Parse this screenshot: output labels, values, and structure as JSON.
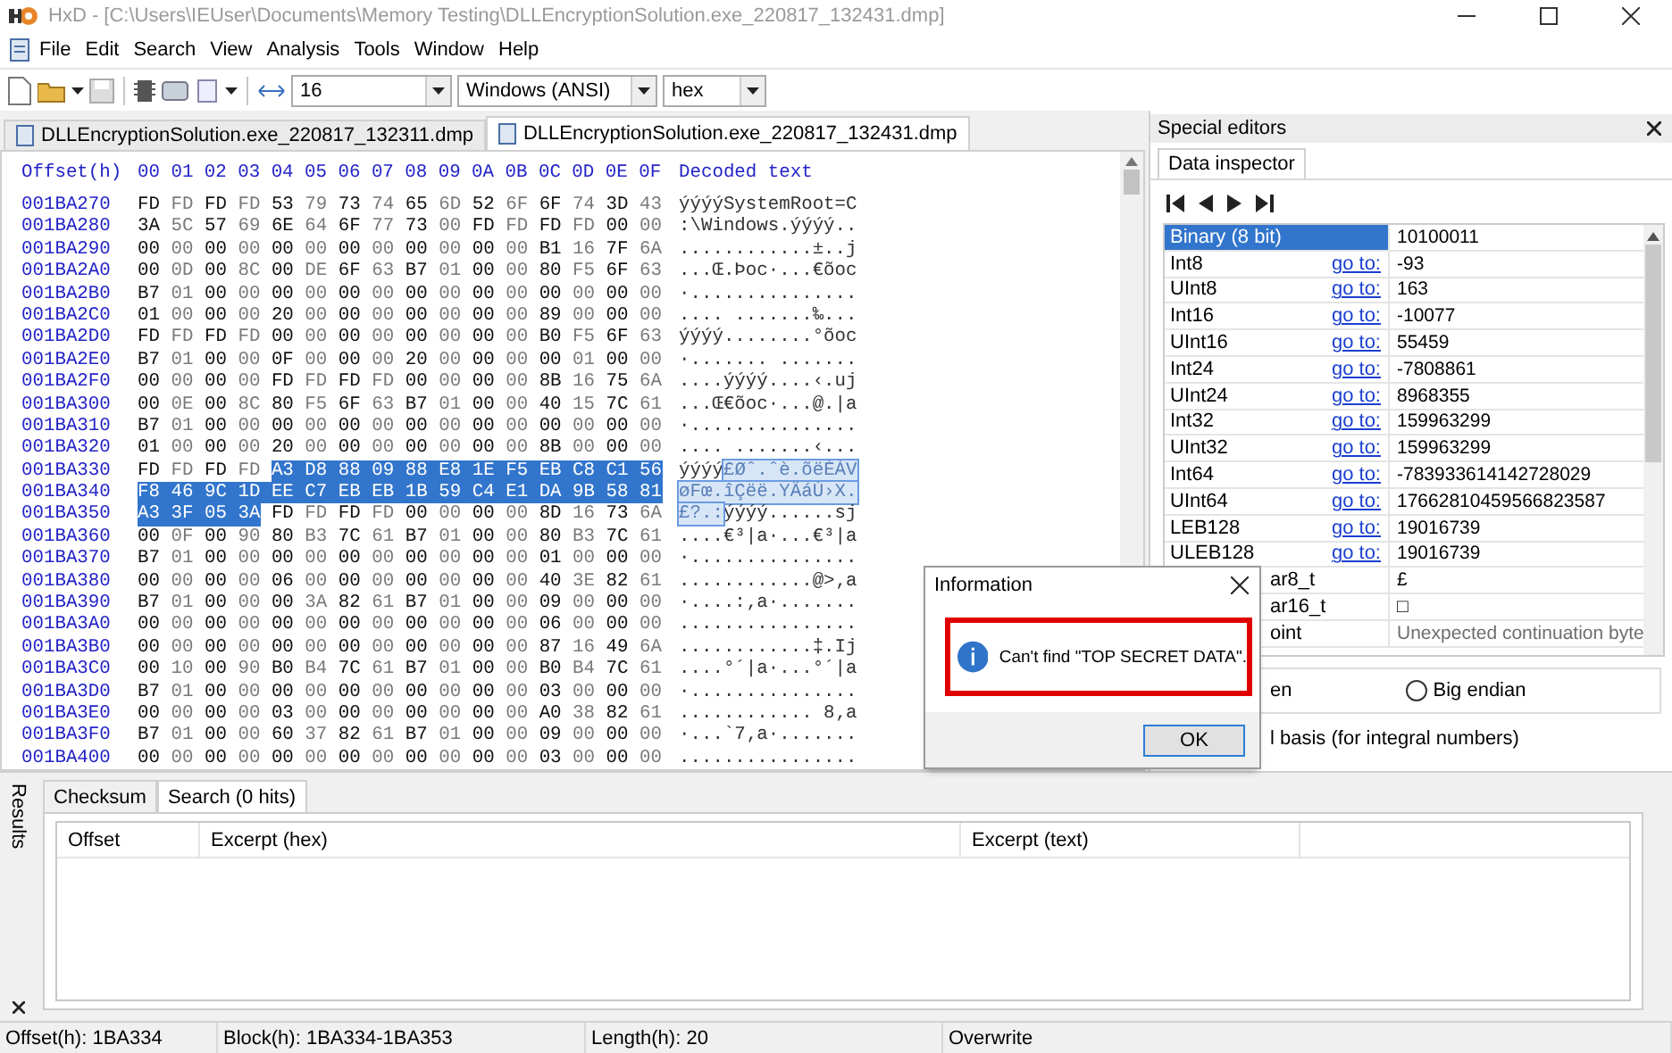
{
  "window": {
    "title": "HxD - [C:\\Users\\IEUser\\Documents\\Memory Testing\\DLLEncryptionSolution.exe_220817_132431.dmp]"
  },
  "menu": [
    "File",
    "Edit",
    "Search",
    "View",
    "Analysis",
    "Tools",
    "Window",
    "Help"
  ],
  "toolbar": {
    "combos": [
      {
        "value": "16"
      },
      {
        "value": "Windows (ANSI)"
      },
      {
        "value": "hex"
      }
    ]
  },
  "tabs": [
    {
      "label": "DLLEncryptionSolution.exe_220817_132311.dmp",
      "selected": false
    },
    {
      "label": "DLLEncryptionSolution.exe_220817_132431.dmp",
      "selected": true
    }
  ],
  "hex": {
    "offset_header": "Offset(h)",
    "column_header": "00 01 02 03 04 05 06 07 08 09 0A 0B 0C 0D 0E 0F",
    "text_header": "Decoded text",
    "rows": [
      {
        "offset": "001BA270",
        "hex": [
          {
            "text": "FD FD FD FD 53 79 73 74 65 6D 52 6F 6F 74 3D 43",
            "selected": false
          }
        ],
        "text": [
          {
            "text": "ýýýýSystemRoot=C",
            "selected": false
          }
        ]
      },
      {
        "offset": "001BA280",
        "hex": [
          {
            "text": "3A 5C 57 69 6E 64 6F 77 73 00 FD FD FD FD 00 00",
            "selected": false
          }
        ],
        "text": [
          {
            "text": ":\\Windows.ýýýý..",
            "selected": false
          }
        ]
      },
      {
        "offset": "001BA290",
        "hex": [
          {
            "text": "00 00 00 00 00 00 00 00 00 00 00 00 B1 16 7F 6A",
            "selected": false
          }
        ],
        "text": [
          {
            "text": "............±..j",
            "selected": false
          }
        ]
      },
      {
        "offset": "001BA2A0",
        "hex": [
          {
            "text": "00 0D 00 8C 00 DE 6F 63 B7 01 00 00 80 F5 6F 63",
            "selected": false
          }
        ],
        "text": [
          {
            "text": "...Œ.Þoc·...€õoc",
            "selected": false
          }
        ]
      },
      {
        "offset": "001BA2B0",
        "hex": [
          {
            "text": "B7 01 00 00 00 00 00 00 00 00 00 00 00 00 00 00",
            "selected": false
          }
        ],
        "text": [
          {
            "text": "·...............",
            "selected": false
          }
        ]
      },
      {
        "offset": "001BA2C0",
        "hex": [
          {
            "text": "01 00 00 00 20 00 00 00 00 00 00 00 89 00 00 00",
            "selected": false
          }
        ],
        "text": [
          {
            "text": ".... .......‰...",
            "selected": false
          }
        ]
      },
      {
        "offset": "001BA2D0",
        "hex": [
          {
            "text": "FD FD FD FD 00 00 00 00 00 00 00 00 B0 F5 6F 63",
            "selected": false
          }
        ],
        "text": [
          {
            "text": "ýýýý........°õoc",
            "selected": false
          }
        ]
      },
      {
        "offset": "001BA2E0",
        "hex": [
          {
            "text": "B7 01 00 00 0F 00 00 00 20 00 00 00 00 01 00 00",
            "selected": false
          }
        ],
        "text": [
          {
            "text": "·....... .......",
            "selected": false
          }
        ]
      },
      {
        "offset": "001BA2F0",
        "hex": [
          {
            "text": "00 00 00 00 FD FD FD FD 00 00 00 00 8B 16 75 6A",
            "selected": false
          }
        ],
        "text": [
          {
            "text": "....ýýýý....‹.uj",
            "selected": false
          }
        ]
      },
      {
        "offset": "001BA300",
        "hex": [
          {
            "text": "00 0E 00 8C 80 F5 6F 63 B7 01 00 00 40 15 7C 61",
            "selected": false
          }
        ],
        "text": [
          {
            "text": "...Œ€õoc·...@.|a",
            "selected": false
          }
        ]
      },
      {
        "offset": "001BA310",
        "hex": [
          {
            "text": "B7 01 00 00 00 00 00 00 00 00 00 00 00 00 00 00",
            "selected": false
          }
        ],
        "text": [
          {
            "text": "·...............",
            "selected": false
          }
        ]
      },
      {
        "offset": "001BA320",
        "hex": [
          {
            "text": "01 00 00 00 20 00 00 00 00 00 00 00 8B 00 00 00",
            "selected": false
          }
        ],
        "text": [
          {
            "text": ".... .......‹...",
            "selected": false
          }
        ]
      },
      {
        "offset": "001BA330",
        "hex": [
          {
            "text": "FD FD FD FD",
            "selected": false
          },
          {
            "text": "A3 D8 88 09 88 E8 1E F5 EB C8 C1 56",
            "selected": true
          }
        ],
        "text": [
          {
            "text": "ýýýý",
            "selected": false
          },
          {
            "text": "£Øˆ.ˆè.õëÈÁV",
            "selected": true
          }
        ]
      },
      {
        "offset": "001BA340",
        "hex": [
          {
            "text": "F8 46 9C 1D EE C7 EB EB 1B 59 C4 E1 DA 9B 58 81",
            "selected": true
          }
        ],
        "text": [
          {
            "text": "øFœ.îÇëë.YÄáÚ›X.",
            "selected": true
          }
        ]
      },
      {
        "offset": "001BA350",
        "hex": [
          {
            "text": "A3 3F 05 3A",
            "selected": true
          },
          {
            "text": "FD FD FD FD 00 00 00 00 8D 16 73 6A",
            "selected": false
          }
        ],
        "text": [
          {
            "text": "£?.:",
            "selected": true
          },
          {
            "text": "ýýýý......sj",
            "selected": false
          }
        ]
      },
      {
        "offset": "001BA360",
        "hex": [
          {
            "text": "00 0F 00 90 80 B3 7C 61 B7 01 00 00 80 B3 7C 61",
            "selected": false
          }
        ],
        "text": [
          {
            "text": "....€³|a·...€³|a",
            "selected": false
          }
        ]
      },
      {
        "offset": "001BA370",
        "hex": [
          {
            "text": "B7 01 00 00 00 00 00 00 00 00 00 00 01 00 00 00",
            "selected": false
          }
        ],
        "text": [
          {
            "text": "·...............",
            "selected": false
          }
        ]
      },
      {
        "offset": "001BA380",
        "hex": [
          {
            "text": "00 00 00 00 06 00 00 00 00 00 00 00 40 3E 82 61",
            "selected": false
          }
        ],
        "text": [
          {
            "text": "............@>‚a",
            "selected": false
          }
        ]
      },
      {
        "offset": "001BA390",
        "hex": [
          {
            "text": "B7 01 00 00 00 3A 82 61 B7 01 00 00 09 00 00 00",
            "selected": false
          }
        ],
        "text": [
          {
            "text": "·....:‚a·.......",
            "selected": false
          }
        ]
      },
      {
        "offset": "001BA3A0",
        "hex": [
          {
            "text": "00 00 00 00 00 00 00 00 00 00 00 00 06 00 00 00",
            "selected": false
          }
        ],
        "text": [
          {
            "text": "................",
            "selected": false
          }
        ]
      },
      {
        "offset": "001BA3B0",
        "hex": [
          {
            "text": "00 00 00 00 00 00 00 00 00 00 00 00 87 16 49 6A",
            "selected": false
          }
        ],
        "text": [
          {
            "text": "............‡.Ij",
            "selected": false
          }
        ]
      },
      {
        "offset": "001BA3C0",
        "hex": [
          {
            "text": "00 10 00 90 B0 B4 7C 61 B7 01 00 00 B0 B4 7C 61",
            "selected": false
          }
        ],
        "text": [
          {
            "text": "....°´|a·...°´|a",
            "selected": false
          }
        ]
      },
      {
        "offset": "001BA3D0",
        "hex": [
          {
            "text": "B7 01 00 00 00 00 00 00 00 00 00 00 03 00 00 00",
            "selected": false
          }
        ],
        "text": [
          {
            "text": "·...............",
            "selected": false
          }
        ]
      },
      {
        "offset": "001BA3E0",
        "hex": [
          {
            "text": "00 00 00 00 03 00 00 00 00 00 00 00 A0 38 82 61",
            "selected": false
          }
        ],
        "text": [
          {
            "text": "............ 8‚a",
            "selected": false
          }
        ]
      },
      {
        "offset": "001BA3F0",
        "hex": [
          {
            "text": "B7 01 00 00 60 37 82 61 B7 01 00 00 09 00 00 00",
            "selected": false
          }
        ],
        "text": [
          {
            "text": "·...`7‚a·.......",
            "selected": false
          }
        ]
      },
      {
        "offset": "001BA400",
        "hex": [
          {
            "text": "00 00 00 00 00 00 00 00 00 00 00 00 03 00 00 00",
            "selected": false
          }
        ],
        "text": [
          {
            "text": "................",
            "selected": false
          }
        ]
      }
    ]
  },
  "special_editors": {
    "title": "Special editors",
    "tabs": [
      {
        "label": "Data inspector",
        "selected": true
      }
    ],
    "rows": [
      {
        "label": "Binary (8 bit)",
        "value": "10100011",
        "selected": true,
        "disabled": false,
        "covered": false
      },
      {
        "label": "Int8",
        "link": "go to:",
        "value": "-93",
        "selected": false,
        "disabled": false,
        "covered": false
      },
      {
        "label": "UInt8",
        "link": "go to:",
        "value": "163",
        "selected": false,
        "disabled": false,
        "covered": false
      },
      {
        "label": "Int16",
        "link": "go to:",
        "value": "-10077",
        "selected": false,
        "disabled": false,
        "covered": false
      },
      {
        "label": "UInt16",
        "link": "go to:",
        "value": "55459",
        "selected": false,
        "disabled": false,
        "covered": false
      },
      {
        "label": "Int24",
        "link": "go to:",
        "value": "-7808861",
        "selected": false,
        "disabled": false,
        "covered": false
      },
      {
        "label": "UInt24",
        "link": "go to:",
        "value": "8968355",
        "selected": false,
        "disabled": false,
        "covered": false
      },
      {
        "label": "Int32",
        "link": "go to:",
        "value": "159963299",
        "selected": false,
        "disabled": false,
        "covered": false
      },
      {
        "label": "UInt32",
        "link": "go to:",
        "value": "159963299",
        "selected": false,
        "disabled": false,
        "covered": false
      },
      {
        "label": "Int64",
        "link": "go to:",
        "value": "-783933614142728029",
        "selected": false,
        "disabled": false,
        "covered": false
      },
      {
        "label": "UInt64",
        "link": "go to:",
        "value": "17662810459566823587",
        "selected": false,
        "disabled": false,
        "covered": false
      },
      {
        "label": "LEB128",
        "link": "go to:",
        "value": "19016739",
        "selected": false,
        "disabled": false,
        "covered": false
      },
      {
        "label": "ULEB128",
        "link": "go to:",
        "value": "19016739",
        "selected": false,
        "disabled": false,
        "covered": false
      },
      {
        "label": "ar8_t",
        "value": "£",
        "selected": false,
        "disabled": false,
        "covered": true
      },
      {
        "label": "ar16_t",
        "value": "□",
        "selected": false,
        "disabled": false,
        "covered": true
      },
      {
        "label": "oint",
        "value": "Unexpected continuation byte",
        "selected": false,
        "disabled": true,
        "covered": true
      }
    ],
    "byte_order_fragment": "en",
    "radios": [
      {
        "label": "Big endian",
        "selected": false
      }
    ],
    "basis_fragment": "l basis (for integral numbers)"
  },
  "results": {
    "title": "Results",
    "tabs": [
      {
        "label": "Checksum",
        "selected": false
      },
      {
        "label": "Search (0 hits)",
        "selected": true
      }
    ],
    "columns": [
      "Offset",
      "Excerpt (hex)",
      "Excerpt (text)"
    ]
  },
  "dialog": {
    "title": "Information",
    "message": "Can't find \"TOP SECRET DATA\".",
    "button": "OK"
  },
  "status_bar": [
    "Offset(h): 1BA334",
    "Block(h): 1BA334-1BA353",
    "Length(h): 20",
    "Overwrite"
  ]
}
